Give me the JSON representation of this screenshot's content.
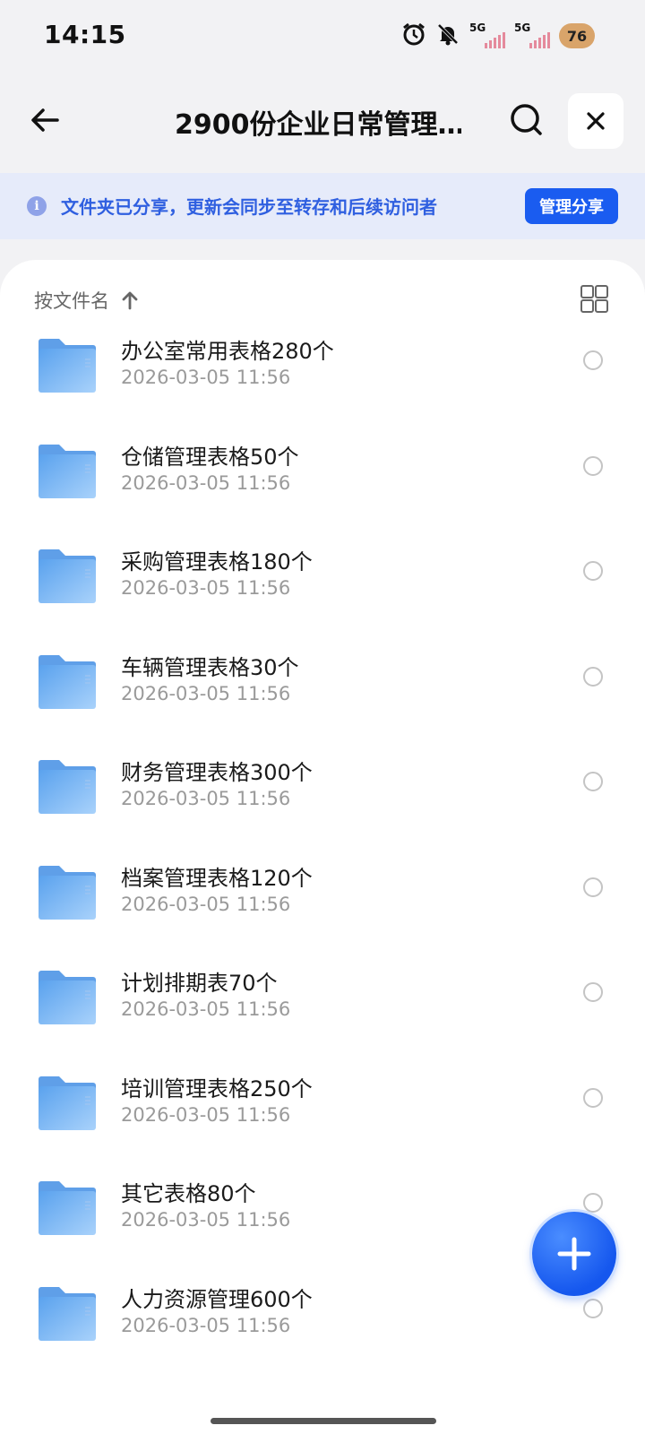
{
  "status_bar": {
    "time": "14:15",
    "sim1_label": "5G",
    "sim2_label": "5G",
    "battery": "76",
    "icons": [
      "alarm-icon",
      "bell-off-icon",
      "signal-icon",
      "signal-icon",
      "battery-icon"
    ]
  },
  "header": {
    "title": "2900份企业日常管理…",
    "back_icon": "arrow-left-icon",
    "search_icon": "search-icon",
    "close_icon": "close-icon"
  },
  "share_banner": {
    "info_icon": "i",
    "text": "文件夹已分享，更新会同步至转存和后续访问者",
    "button_label": "管理分享"
  },
  "sort_bar": {
    "label": "按文件名",
    "direction_icon": "arrow-up-icon",
    "view_toggle_icon": "grid-view-icon"
  },
  "files": [
    {
      "name": "办公室常用表格280个",
      "date": "2026-03-05 11:56"
    },
    {
      "name": "仓储管理表格50个",
      "date": "2026-03-05 11:56"
    },
    {
      "name": "采购管理表格180个",
      "date": "2026-03-05 11:56"
    },
    {
      "name": "车辆管理表格30个",
      "date": "2026-03-05 11:56"
    },
    {
      "name": "财务管理表格300个",
      "date": "2026-03-05 11:56"
    },
    {
      "name": "档案管理表格120个",
      "date": "2026-03-05 11:56"
    },
    {
      "name": "计划排期表70个",
      "date": "2026-03-05 11:56"
    },
    {
      "name": "培训管理表格250个",
      "date": "2026-03-05 11:56"
    },
    {
      "name": "其它表格80个",
      "date": "2026-03-05 11:56"
    },
    {
      "name": "人力资源管理600个",
      "date": "2026-03-05 11:56"
    }
  ],
  "fab": {
    "icon": "plus-icon"
  },
  "colors": {
    "accent": "#1a5cf0",
    "banner_bg": "#e6ebfa",
    "banner_text": "#2f5fe0",
    "folder": "#7ab8f5"
  }
}
